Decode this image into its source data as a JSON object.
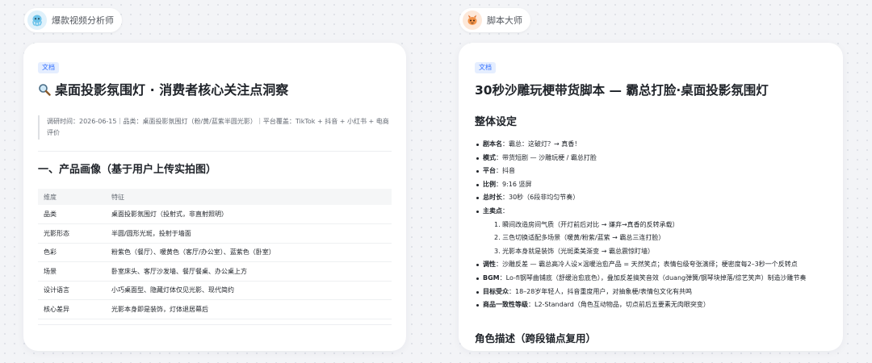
{
  "left_panel": {
    "agent_name": "爆款视频分析师",
    "badge": "文档",
    "title": "桌面投影氛围灯 · 消费者核心关注点洞察",
    "meta_line1": "调研时间：2026-06-15｜品类：桌面投影氛围灯（粉/黄/蓝紫半圆光影）｜平台覆盖：TikTok + 抖音 + 小红书 + 电商",
    "meta_line2": "评价",
    "section_title": "一、产品画像（基于用户上传实拍图）",
    "table": {
      "headers": [
        "维度",
        "特征"
      ],
      "rows": [
        [
          "品类",
          "桌面投影氛围灯（投射式，非直射照明）"
        ],
        [
          "光影形态",
          "半圆/圆形光斑，投射于墙面"
        ],
        [
          "色彩",
          "粉紫色（餐厅）、暖黄色（客厅/办公室）、蓝紫色（卧室）"
        ],
        [
          "场景",
          "卧室床头、客厅沙发墙、餐厅餐桌、办公桌上方"
        ],
        [
          "设计语言",
          "小巧桌面型、隐藏灯体仅见光影、现代简约"
        ],
        [
          "核心差异",
          "光影本身即是装饰，灯体退居幕后"
        ]
      ]
    }
  },
  "right_panel": {
    "agent_name": "脚本大师",
    "badge": "文档",
    "title": "30秒沙雕玩梗带货脚本 — 霸总打脸·桌面投影氛围灯",
    "section_title": "整体设定",
    "settings": [
      {
        "label": "剧本名",
        "value": "：霸总：这破灯？→ 真香！"
      },
      {
        "label": "模式",
        "value": "：带货短剧 — 沙雕玩梗 / 霸总打脸"
      },
      {
        "label": "平台",
        "value": "：抖音"
      },
      {
        "label": "比例",
        "value": "：9:16 竖屏"
      },
      {
        "label": "总时长",
        "value": "：30秒（6段非均匀节奏）"
      },
      {
        "label": "主卖点",
        "value": "："
      }
    ],
    "selling_points": [
      "1. 瞬间改造房间气质（开灯前后对比 → 嫌弃→真香的反转承载）",
      "2. 三色切换适配多场景（暖黄/粉紫/蓝紫 → 霸总三连打脸）",
      "3. 光影本身就是装饰（光斑柔美渐变 → 霸总震惊盯墙）"
    ],
    "settings_tail": [
      {
        "label": "调性",
        "value": "：沙雕反差 — 霸总高冷人设×温暖治愈产品 = 天然笑点；表情包级夸张演绎；梗密度每2–3秒一个反转点"
      },
      {
        "label": "BGM",
        "value": "：Lo-fi钢琴曲铺底（舒缓治愈底色），叠加反差搞笑音效（duang弹簧/钢琴块掉落/综艺笑声）制造沙雕节奏"
      },
      {
        "label": "目标受众",
        "value": "：18–28岁年轻人，抖音重度用户，对抽象梗/表情包文化有共鸣"
      },
      {
        "label": "商品一致性等级",
        "value": "：L2-Standard（角色互动物品，切点前后五要素无肉眼突变）"
      }
    ],
    "role_title": "角色描述（跨段锚点复用）"
  },
  "colors": {
    "accent": "#3370ff",
    "badge_bg": "#e5eeff",
    "text": "#1f2329",
    "muted": "#646a73"
  },
  "icons": {
    "left_avatar": "blue-octopus-avatar-icon",
    "right_avatar": "orange-dragon-avatar-icon",
    "title_icon": "magnifier-icon"
  }
}
